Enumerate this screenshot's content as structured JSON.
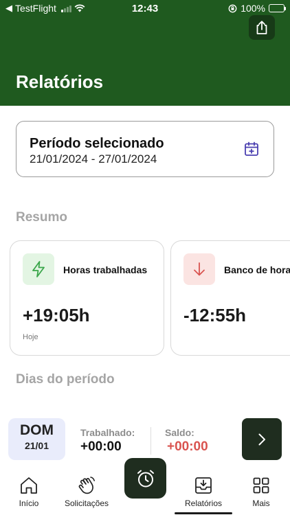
{
  "status_bar": {
    "carrier": "TestFlight",
    "time": "12:43",
    "battery": "100%"
  },
  "header": {
    "title": "Relatórios",
    "share_icon": "share-icon"
  },
  "period": {
    "title": "Período selecionado",
    "range": "21/01/2024 - 27/01/2024",
    "icon": "calendar-plus-icon"
  },
  "summary": {
    "title": "Resumo",
    "cards": [
      {
        "label": "Horas trabalhadas",
        "value": "+19:05h",
        "sub": "Hoje",
        "icon": "lightning-icon",
        "icon_bg": "#e3f5e3",
        "icon_color": "#3aa64a"
      },
      {
        "label": "Banco de horas",
        "value": "-12:55h",
        "sub": "",
        "icon": "arrow-down-icon",
        "icon_bg": "#fbe4e2",
        "icon_color": "#d9534f"
      }
    ]
  },
  "days": {
    "title": "Dias do período",
    "rows": [
      {
        "day": "DOM",
        "date": "21/01",
        "worked_label": "Trabalhado:",
        "worked_value": "+00:00",
        "balance_label": "Saldo:",
        "balance_value": "+00:00"
      }
    ]
  },
  "tabs": [
    {
      "label": "Início",
      "icon": "home-icon"
    },
    {
      "label": "Solicitações",
      "icon": "hand-wave-icon"
    },
    {
      "label": "",
      "icon": "alarm-clock-icon"
    },
    {
      "label": "Relatórios",
      "icon": "download-tray-icon",
      "active": true
    },
    {
      "label": "Mais",
      "icon": "grid-icon"
    }
  ],
  "colors": {
    "header_bg": "#1f5a1f",
    "dark_button": "#1f2d1f",
    "negative": "#d9534f",
    "day_badge_bg": "#e9ecfb"
  }
}
